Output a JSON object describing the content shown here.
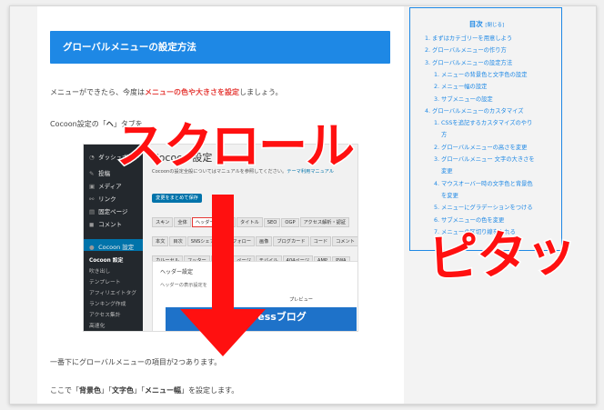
{
  "article": {
    "heading": "グローバルメニューの設定方法",
    "p1_before": "メニューができたら、今度は",
    "p1_red": "メニューの色や大きさを設定",
    "p1_after": "しましょう。",
    "p2_before": "Cocoon設定の「",
    "p2_bold": "ヘ",
    "p2_mid": "」タブを",
    "p3": "一番下にグローバルメニューの項目が2つあります。",
    "p4_before": "ここで「",
    "p4_b1": "背景色",
    "p4_s1": "」「",
    "p4_b2": "文字色",
    "p4_s2": "」「",
    "p4_b3": "メニュー幅",
    "p4_after": "」を設定します。"
  },
  "screenshot": {
    "sidebar": [
      {
        "icon": "dashboard-icon",
        "glyph": "◔",
        "label": "ダッシュボード"
      },
      {
        "icon": "pin-icon",
        "glyph": "✎",
        "label": "投稿"
      },
      {
        "icon": "media-icon",
        "glyph": "▣",
        "label": "メディア"
      },
      {
        "icon": "link-icon",
        "glyph": "⚯",
        "label": "リンク"
      },
      {
        "icon": "page-icon",
        "glyph": "▤",
        "label": "固定ページ"
      },
      {
        "icon": "comment-icon",
        "glyph": "◼",
        "label": "コメント"
      }
    ],
    "active_item": "Cocoon 設定",
    "submenu": [
      "Cocoon 設定",
      "吹き出し",
      "テンプレート",
      "アフィリエイトタグ",
      "ランキング作成",
      "アクセス集計",
      "高速化"
    ],
    "page_title": "Cocoon 設定",
    "note_before": "Cocoonの設定全般についてはマニュアルを参照してください。",
    "note_link": "テーマ利用マニュアル",
    "save_label": "変更をまとめて保存",
    "tabs_row1": [
      "スキン",
      "全体",
      "ヘッダー",
      "広告",
      "タイトル",
      "SEO",
      "OGP",
      "アクセス解析・認証"
    ],
    "tabs_row2": [
      "本文",
      "目次",
      "SNSシェア",
      "SNSフォロー",
      "画像",
      "ブログカード",
      "コード",
      "コメント"
    ],
    "tabs_row3": [
      "カルーセル",
      "フッター",
      "ボタン",
      "ページ",
      "モバイル",
      "404ページ",
      "AMP",
      "PWA",
      "管理者画面"
    ],
    "tabs_row4": [
      "エディター",
      "API",
      "その他",
      "リセット",
      "テーマ情報"
    ],
    "panel_heading": "ヘッダー設定",
    "panel_desc": "ヘッダーの表示設定を",
    "preview_label": "プレビュー",
    "banner_text": "WordPressブログ"
  },
  "toc": {
    "title": "目次",
    "close_label": "[閉じる]",
    "items": [
      {
        "num": "1.",
        "text": "まずはカテゴリーを用意しよう",
        "level": 0
      },
      {
        "num": "2.",
        "text": "グローバルメニューの作り方",
        "level": 0
      },
      {
        "num": "3.",
        "text": "グローバルメニューの設定方法",
        "level": 0
      },
      {
        "num": "1.",
        "text": "メニューの背景色と文字色の設定",
        "level": 1
      },
      {
        "num": "2.",
        "text": "メニュー幅の設定",
        "level": 1
      },
      {
        "num": "3.",
        "text": "サブメニューの設定",
        "level": 1
      },
      {
        "num": "4.",
        "text": "グローバルメニューのカスタマイズ",
        "level": 0
      },
      {
        "num": "1.",
        "text": "CSSを追記するカスタマイズのやり",
        "level": 1
      },
      {
        "num": "",
        "text": "方",
        "level": 2
      },
      {
        "num": "2.",
        "text": "グローバルメニューの高さを変更",
        "level": 1
      },
      {
        "num": "3.",
        "text": "グローバルメニュー 文字の大きさを",
        "level": 1
      },
      {
        "num": "",
        "text": "変更",
        "level": 2
      },
      {
        "num": "4.",
        "text": "マウスオーバー時の文字色と背景色",
        "level": 1
      },
      {
        "num": "",
        "text": "を変更",
        "level": 2
      },
      {
        "num": "5.",
        "text": "メニューにグラデーションをつける",
        "level": 1
      },
      {
        "num": "6.",
        "text": "サブメニューの色を変更",
        "level": 1
      },
      {
        "num": "7.",
        "text": "メニューの区切り線を入れる",
        "level": 1
      }
    ]
  },
  "overlay": {
    "scroll_text": "スクロール",
    "sticky_text": "ピタッ",
    "color": "#ff1010"
  },
  "colors": {
    "accent": "#1e88e5",
    "wp_sidebar": "#23282d",
    "wp_active": "#0073aa"
  }
}
